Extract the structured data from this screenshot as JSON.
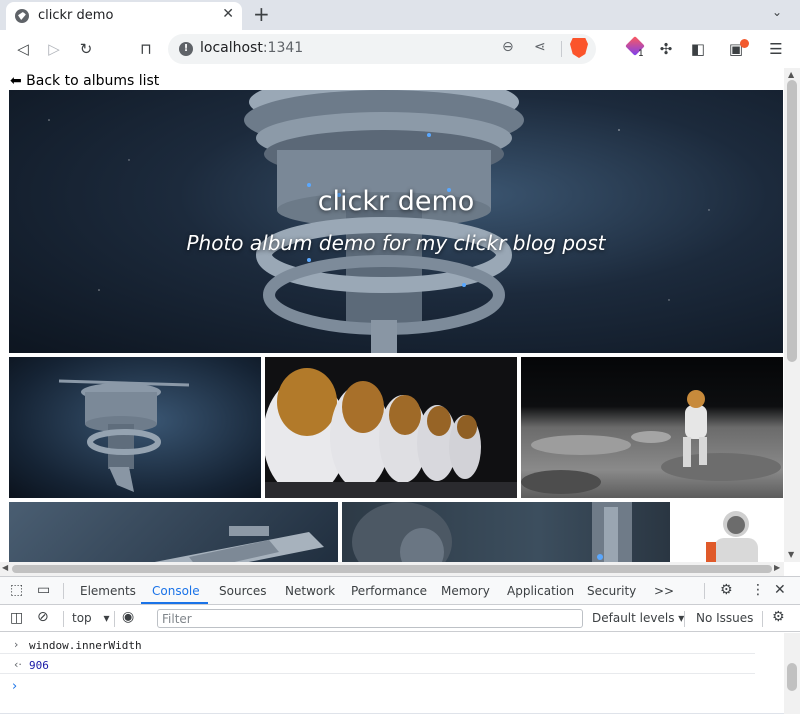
{
  "browser": {
    "tab_title": "clickr demo",
    "tab_close": "✕",
    "new_tab": "+",
    "tab_menu": "⌄",
    "url_host": "localhost",
    "url_port": ":1341",
    "extensions_badge": "1"
  },
  "page": {
    "back_link": "⬅ Back to albums list",
    "hero_title": "clickr demo",
    "hero_subtitle": "Photo album demo for my clickr blog post"
  },
  "devtools": {
    "tabs": [
      "Elements",
      "Console",
      "Sources",
      "Network",
      "Performance",
      "Memory",
      "Application",
      "Security"
    ],
    "active_tab": "Console",
    "more_tabs": ">>",
    "context": "top",
    "filter_placeholder": "Filter",
    "levels": "Default levels ▾",
    "issues": "No Issues",
    "console_input": "window.innerWidth",
    "console_output": "906",
    "input_arrow": "›",
    "output_arrow": "‹·",
    "prompt": "›"
  }
}
